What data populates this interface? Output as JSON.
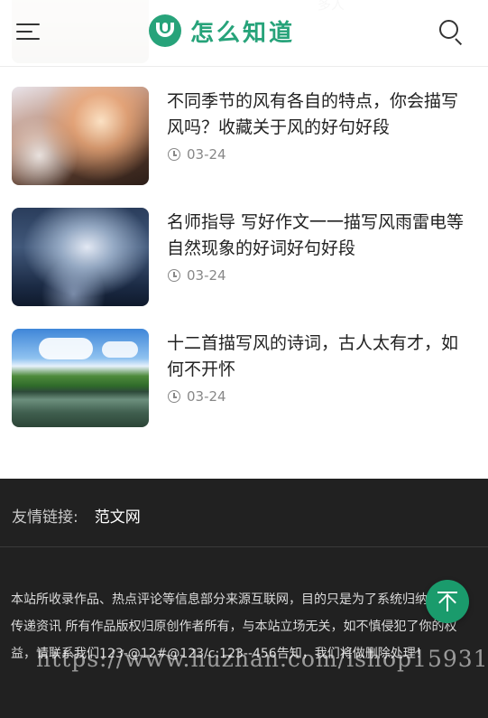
{
  "header": {
    "logo_text": "怎么知道",
    "brand_color": "#27a37a",
    "menu_icon": "menu-icon",
    "search_icon": "search-icon"
  },
  "previous_item": {
    "partial_text": "多人"
  },
  "articles": [
    {
      "title": "不同季节的风有各自的特点，你会描写风吗？收藏关于风的好句好段",
      "date": "03-24",
      "thumb": "snowy-trees-image"
    },
    {
      "title": "名师指导 写好作文一一描写风雨雷电等自然现象的好词好句好段",
      "date": "03-24",
      "thumb": "storm-clouds-image"
    },
    {
      "title": "十二首描写风的诗词，古人太有才，如何不开怀",
      "date": "03-24",
      "thumb": "lake-trees-image"
    }
  ],
  "footer": {
    "friend_links_label": "友情链接:",
    "friend_links": [
      "范文网"
    ],
    "copyright": "本站所收录作品、热点评论等信息部分来源互联网，目的只是为了系统归纳学习和传递资讯 所有作品版权归原创作者所有，与本站立场无关，如不慎侵犯了你的权益，请联系我们123-@12#@123/c:123--456告知，我们将做删除处理！",
    "watermark": "https://www.huzhan.com/ishop15931",
    "back_to_top_icon": "arrow-up-icon",
    "accent_color": "#1a9b6c"
  }
}
